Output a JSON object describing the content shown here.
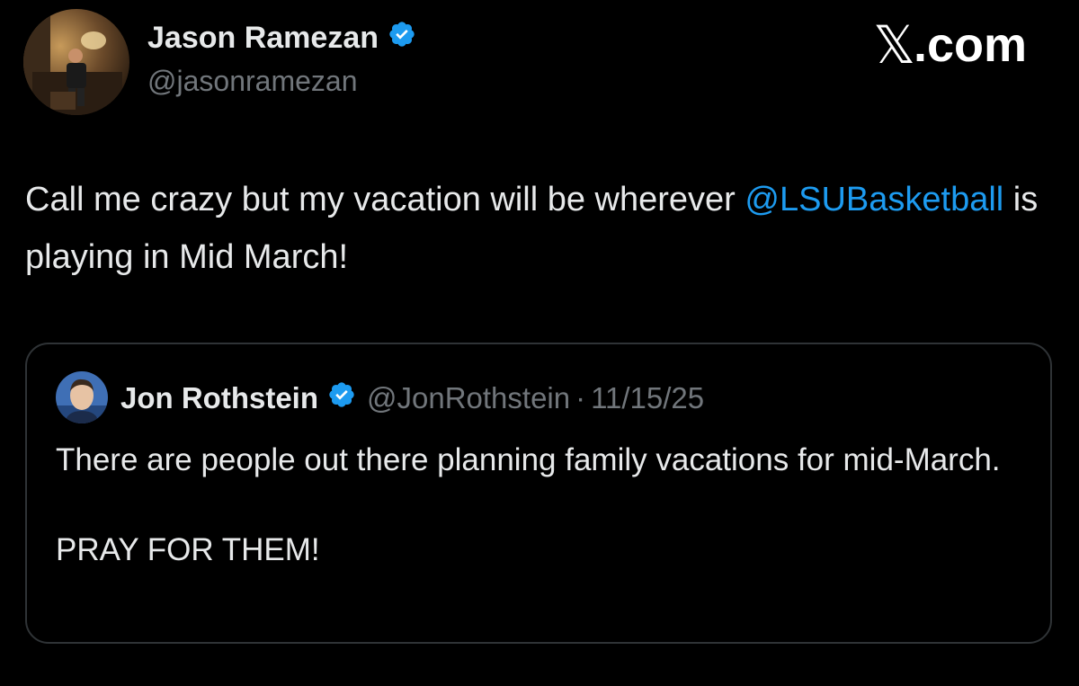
{
  "tweet": {
    "author": {
      "name": "Jason Ramezan",
      "handle": "@jasonramezan",
      "verified": true,
      "avatar_icon": "person-seated-avatar"
    },
    "brand": {
      "x": "𝕏",
      "rest": ".com"
    },
    "text_before": "Call me crazy but my vacation will be wherever ",
    "mention": "@LSUBasketball",
    "text_after": " is playing in Mid March!",
    "quoted_tweet": {
      "author": {
        "name": "Jon Rothstein",
        "handle": "@JonRothstein",
        "verified": true,
        "avatar_icon": "person-headshot-avatar"
      },
      "separator": "·",
      "date": "11/15/25",
      "line1": "There are people out there planning family vacations for mid-March.",
      "line2": "PRAY FOR THEM!"
    }
  },
  "colors": {
    "background": "#000000",
    "text": "#e7e9ea",
    "muted": "#71767b",
    "accent": "#1d9bf0",
    "border": "#2f3336"
  }
}
